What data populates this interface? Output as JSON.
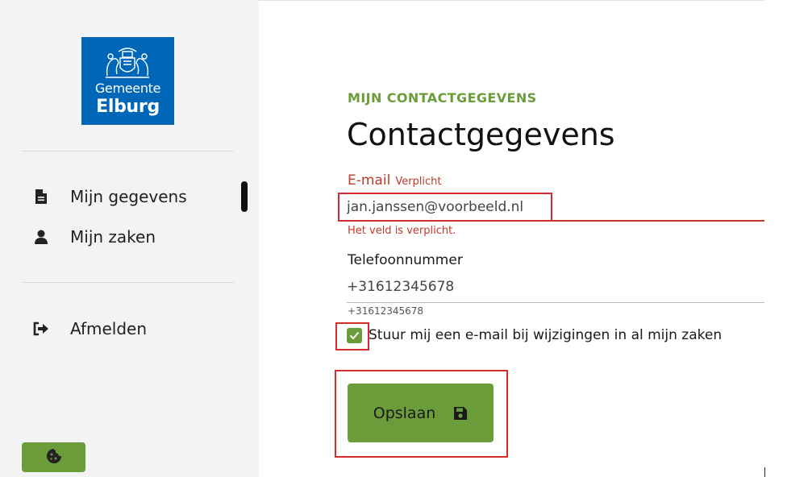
{
  "sidebar": {
    "logo": {
      "line1": "Gemeente",
      "line2": "Elburg"
    },
    "items": [
      {
        "label": "Mijn gegevens",
        "icon": "document-icon",
        "active": true
      },
      {
        "label": "Mijn zaken",
        "icon": "user-icon",
        "active": false
      }
    ],
    "logout": {
      "label": "Afmelden",
      "icon": "sign-out-icon"
    },
    "cookie_icon": "cookie-icon"
  },
  "main": {
    "eyebrow": "MIJN CONTACTGEGEVENS",
    "title": "Contactgegevens",
    "email": {
      "label": "E-mail",
      "required": "Verplicht",
      "value": "jan.janssen@voorbeeld.nl",
      "error": "Het veld is verplicht."
    },
    "phone": {
      "label": "Telefoonnummer",
      "value": "+31612345678",
      "hint": "+31612345678"
    },
    "notify": {
      "checked": true,
      "label": "Stuur mij een e-mail bij wijzigingen in al mijn zaken"
    },
    "save": {
      "label": "Opslaan",
      "icon": "floppy-disk-icon"
    }
  },
  "colors": {
    "brand_green": "#6b9c3a",
    "logo_blue": "#0067b8",
    "error_red": "#c0392b",
    "highlight_red": "#d42b2b",
    "sidebar_bg": "#f3f3f3"
  }
}
